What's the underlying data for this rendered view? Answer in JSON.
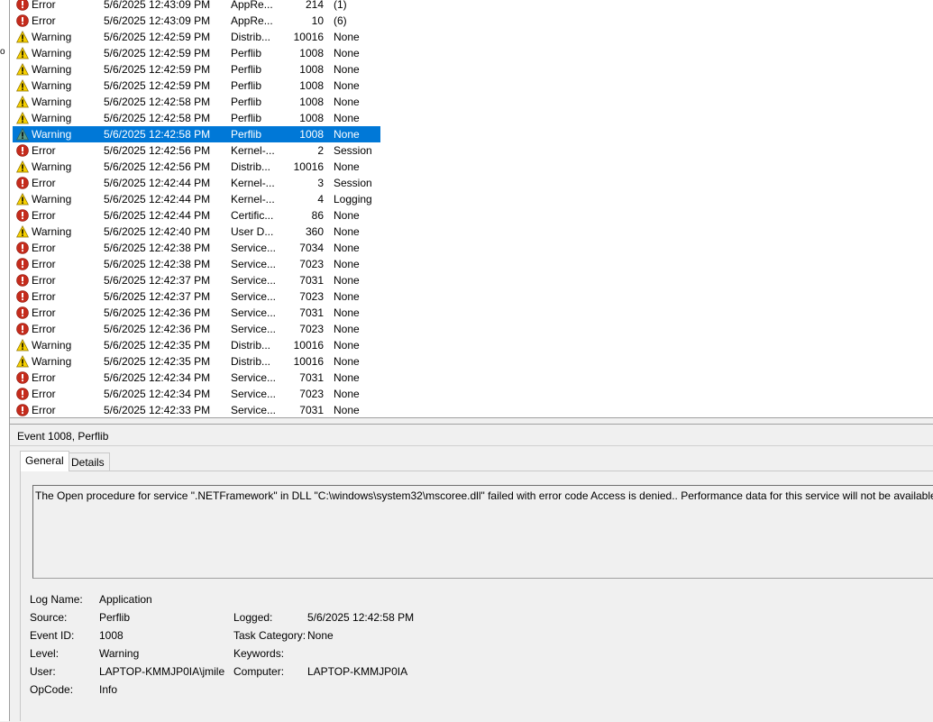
{
  "events": [
    {
      "level": "Error",
      "date": "5/6/2025 12:43:09 PM",
      "source": "AppRe...",
      "event_id": "214",
      "task": "(1)"
    },
    {
      "level": "Error",
      "date": "5/6/2025 12:43:09 PM",
      "source": "AppRe...",
      "event_id": "10",
      "task": "(6)"
    },
    {
      "level": "Warning",
      "date": "5/6/2025 12:42:59 PM",
      "source": "Distrib...",
      "event_id": "10016",
      "task": "None"
    },
    {
      "level": "Warning",
      "date": "5/6/2025 12:42:59 PM",
      "source": "Perflib",
      "event_id": "1008",
      "task": "None"
    },
    {
      "level": "Warning",
      "date": "5/6/2025 12:42:59 PM",
      "source": "Perflib",
      "event_id": "1008",
      "task": "None"
    },
    {
      "level": "Warning",
      "date": "5/6/2025 12:42:59 PM",
      "source": "Perflib",
      "event_id": "1008",
      "task": "None"
    },
    {
      "level": "Warning",
      "date": "5/6/2025 12:42:58 PM",
      "source": "Perflib",
      "event_id": "1008",
      "task": "None"
    },
    {
      "level": "Warning",
      "date": "5/6/2025 12:42:58 PM",
      "source": "Perflib",
      "event_id": "1008",
      "task": "None"
    },
    {
      "level": "Warning",
      "date": "5/6/2025 12:42:58 PM",
      "source": "Perflib",
      "event_id": "1008",
      "task": "None",
      "selected": true
    },
    {
      "level": "Error",
      "date": "5/6/2025 12:42:56 PM",
      "source": "Kernel-...",
      "event_id": "2",
      "task": "Session"
    },
    {
      "level": "Warning",
      "date": "5/6/2025 12:42:56 PM",
      "source": "Distrib...",
      "event_id": "10016",
      "task": "None"
    },
    {
      "level": "Error",
      "date": "5/6/2025 12:42:44 PM",
      "source": "Kernel-...",
      "event_id": "3",
      "task": "Session"
    },
    {
      "level": "Warning",
      "date": "5/6/2025 12:42:44 PM",
      "source": "Kernel-...",
      "event_id": "4",
      "task": "Logging"
    },
    {
      "level": "Error",
      "date": "5/6/2025 12:42:44 PM",
      "source": "Certific...",
      "event_id": "86",
      "task": "None"
    },
    {
      "level": "Warning",
      "date": "5/6/2025 12:42:40 PM",
      "source": "User D...",
      "event_id": "360",
      "task": "None"
    },
    {
      "level": "Error",
      "date": "5/6/2025 12:42:38 PM",
      "source": "Service...",
      "event_id": "7034",
      "task": "None"
    },
    {
      "level": "Error",
      "date": "5/6/2025 12:42:38 PM",
      "source": "Service...",
      "event_id": "7023",
      "task": "None"
    },
    {
      "level": "Error",
      "date": "5/6/2025 12:42:37 PM",
      "source": "Service...",
      "event_id": "7031",
      "task": "None"
    },
    {
      "level": "Error",
      "date": "5/6/2025 12:42:37 PM",
      "source": "Service...",
      "event_id": "7023",
      "task": "None"
    },
    {
      "level": "Error",
      "date": "5/6/2025 12:42:36 PM",
      "source": "Service...",
      "event_id": "7031",
      "task": "None"
    },
    {
      "level": "Error",
      "date": "5/6/2025 12:42:36 PM",
      "source": "Service...",
      "event_id": "7023",
      "task": "None"
    },
    {
      "level": "Warning",
      "date": "5/6/2025 12:42:35 PM",
      "source": "Distrib...",
      "event_id": "10016",
      "task": "None"
    },
    {
      "level": "Warning",
      "date": "5/6/2025 12:42:35 PM",
      "source": "Distrib...",
      "event_id": "10016",
      "task": "None"
    },
    {
      "level": "Error",
      "date": "5/6/2025 12:42:34 PM",
      "source": "Service...",
      "event_id": "7031",
      "task": "None"
    },
    {
      "level": "Error",
      "date": "5/6/2025 12:42:34 PM",
      "source": "Service...",
      "event_id": "7023",
      "task": "None"
    },
    {
      "level": "Error",
      "date": "5/6/2025 12:42:33 PM",
      "source": "Service...",
      "event_id": "7031",
      "task": "None"
    }
  ],
  "left_mark": "o",
  "detail": {
    "header": "Event 1008, Perflib",
    "tabs": [
      "General",
      "Details"
    ],
    "message": "The Open procedure for service \".NETFramework\" in DLL \"C:\\windows\\system32\\mscoree.dll\" failed with error code Access is denied.. Performance data for this service will not be available.",
    "labels": {
      "log_name": "Log Name:",
      "source": "Source:",
      "event_id": "Event ID:",
      "level": "Level:",
      "user": "User:",
      "opcode": "OpCode:",
      "logged": "Logged:",
      "task_category": "Task Category:",
      "keywords": "Keywords:",
      "computer": "Computer:"
    },
    "values": {
      "log_name": "Application",
      "source": "Perflib",
      "event_id": "1008",
      "level": "Warning",
      "user": "LAPTOP-KMMJP0IA\\jmile",
      "opcode": "Info",
      "logged": "5/6/2025 12:42:58 PM",
      "task_category": "None",
      "keywords": "",
      "computer": "LAPTOP-KMMJP0IA"
    }
  },
  "colors": {
    "selection": "#0078d7",
    "error": "#c42b1c",
    "warning": "#f7d000"
  },
  "icons": {
    "error": "error-icon",
    "warning": "warning-icon"
  }
}
